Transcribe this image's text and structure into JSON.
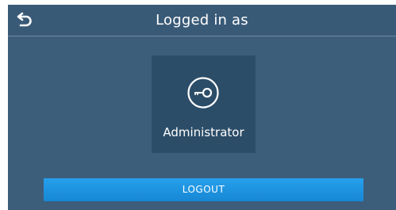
{
  "header": {
    "title": "Logged in as",
    "back_icon": "back-arrow-icon"
  },
  "user": {
    "icon": "key-icon",
    "role": "Administrator"
  },
  "actions": {
    "logout_label": "LOGOUT"
  },
  "colors": {
    "screen_bg": "#3d5e7b",
    "header_bg": "#395a77",
    "tile_bg": "#2c4d68",
    "button_bg": "#1e93e0",
    "text": "#ffffff"
  }
}
